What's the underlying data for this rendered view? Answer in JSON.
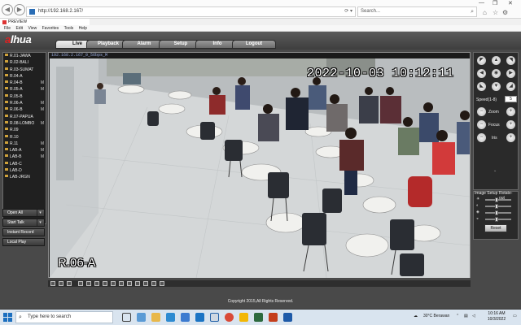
{
  "browser": {
    "address": "http://192.168.2.167/",
    "search_placeholder": "Search...",
    "tab_title": "PREVIEW",
    "menu": [
      "File",
      "Edit",
      "View",
      "Favorites",
      "Tools",
      "Help"
    ]
  },
  "app": {
    "logo": "alhua",
    "logo_accent": "a",
    "nav": [
      "Live",
      "Playback",
      "Alarm",
      "Setup",
      "Info",
      "Logout"
    ],
    "active_nav": "Live",
    "cameras": [
      {
        "label": "R.01-JAWA",
        "mark": ""
      },
      {
        "label": "R.02-BALI",
        "mark": ""
      },
      {
        "label": "R.03-SUMAT",
        "mark": ""
      },
      {
        "label": "R.04-A",
        "mark": ""
      },
      {
        "label": "R.04-B",
        "mark": "M"
      },
      {
        "label": "R.05-A",
        "mark": "M"
      },
      {
        "label": "R.05-B",
        "mark": ""
      },
      {
        "label": "R.06-A",
        "mark": "M"
      },
      {
        "label": "R.06-B",
        "mark": "M"
      },
      {
        "label": "R.07-PAPUA",
        "mark": ""
      },
      {
        "label": "R.08-LOMBO",
        "mark": "M"
      },
      {
        "label": "R.09",
        "mark": ""
      },
      {
        "label": "R.10",
        "mark": ""
      },
      {
        "label": "R.11",
        "mark": "M"
      },
      {
        "label": "LAB-A",
        "mark": "M"
      },
      {
        "label": "LAB-B",
        "mark": "M"
      },
      {
        "label": "LAB-C",
        "mark": ""
      },
      {
        "label": "LAB-D",
        "mark": ""
      },
      {
        "label": "LAB-JRGN",
        "mark": ""
      }
    ],
    "open_all": "Open All",
    "start_talk": "Start Talk",
    "instant_record": "Instant Record",
    "local_play": "Local Play",
    "copyright": "Copyright 2015,All Rights Reserved."
  },
  "video": {
    "header": "192.168.2.167_0_56bps_M",
    "timestamp": "2022-10-03 10:12:11",
    "channel_name": "R.06-A"
  },
  "ptz": {
    "speed_label": "Speed(1-8)",
    "speed_value": "5",
    "zoom_label": "Zoom",
    "focus_label": "Focus",
    "iris_label": "Iris",
    "image_setup": "Image Setup",
    "rotate": "Rotate-out",
    "reset": "Reset"
  },
  "taskbar": {
    "search": "Type here to search",
    "weather": "30°C Berawan",
    "time": "10:16 AM",
    "date": "10/3/2022"
  },
  "colors": {
    "accent_red": "#d22222",
    "panel_dark": "#202020"
  }
}
